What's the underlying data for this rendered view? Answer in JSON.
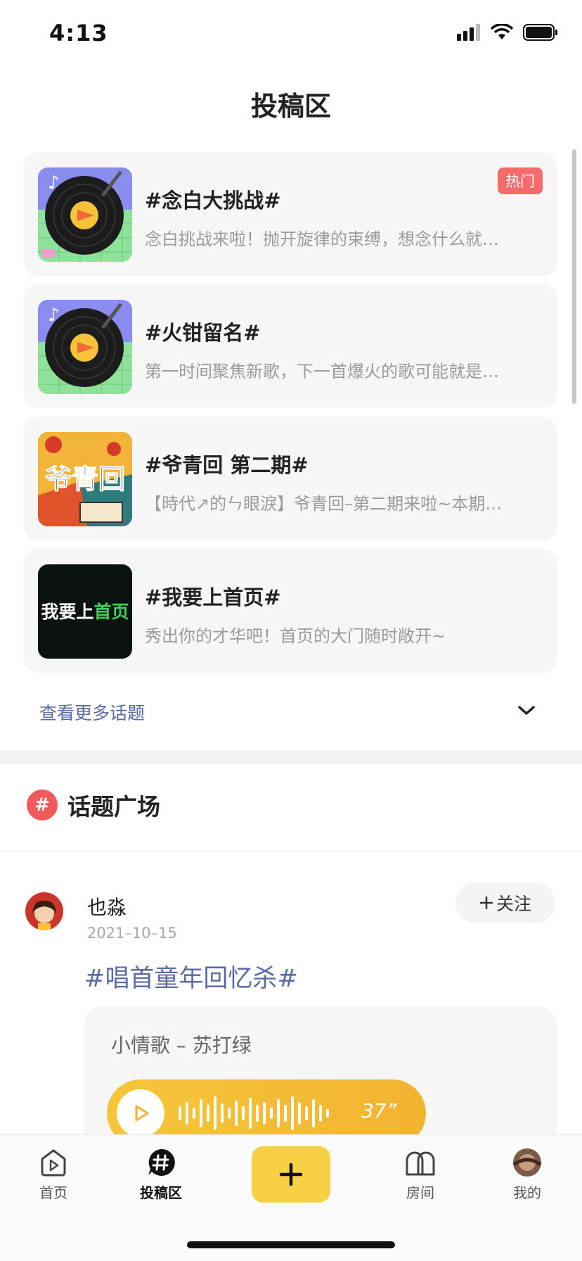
{
  "status": {
    "time": "4:13"
  },
  "page": {
    "title": "投稿区"
  },
  "topics": [
    {
      "title": "#念白大挑战#",
      "desc": "念白挑战来啦！抛开旋律的束缚，想念什么就…",
      "badge": "热门",
      "thumb": "vinyl-record-icon"
    },
    {
      "title": "#火钳留名#",
      "desc": "第一时间聚焦新歌，下一首爆火的歌可能就是…",
      "thumb": "vinyl-record-icon"
    },
    {
      "title": "#爷青回 第二期#",
      "desc": "【時代↗的ㄣ眼淚】爷青回–第二期来啦~本期…",
      "thumb_text": "爷青回"
    },
    {
      "title": "#我要上首页#",
      "desc": "秀出你的才华吧！首页的大门随时敞开~",
      "thumb_text_a": "我要上",
      "thumb_text_b": "首页"
    }
  ],
  "more_topics_label": "查看更多话题",
  "plaza": {
    "icon_text": "#",
    "title": "话题广场"
  },
  "post": {
    "username": "也淼",
    "date": "2021–10–15",
    "follow_label": "关注",
    "topic": "#唱首童年回忆杀#",
    "song": "小情歌 – 苏打绿",
    "duration": "37”"
  },
  "tabs": {
    "home": "首页",
    "submit": "投稿区",
    "rooms": "房间",
    "mine": "我的"
  },
  "colors": {
    "accent": "#f7d046",
    "link": "#5c6aa8",
    "hot": "#f56b6b"
  }
}
